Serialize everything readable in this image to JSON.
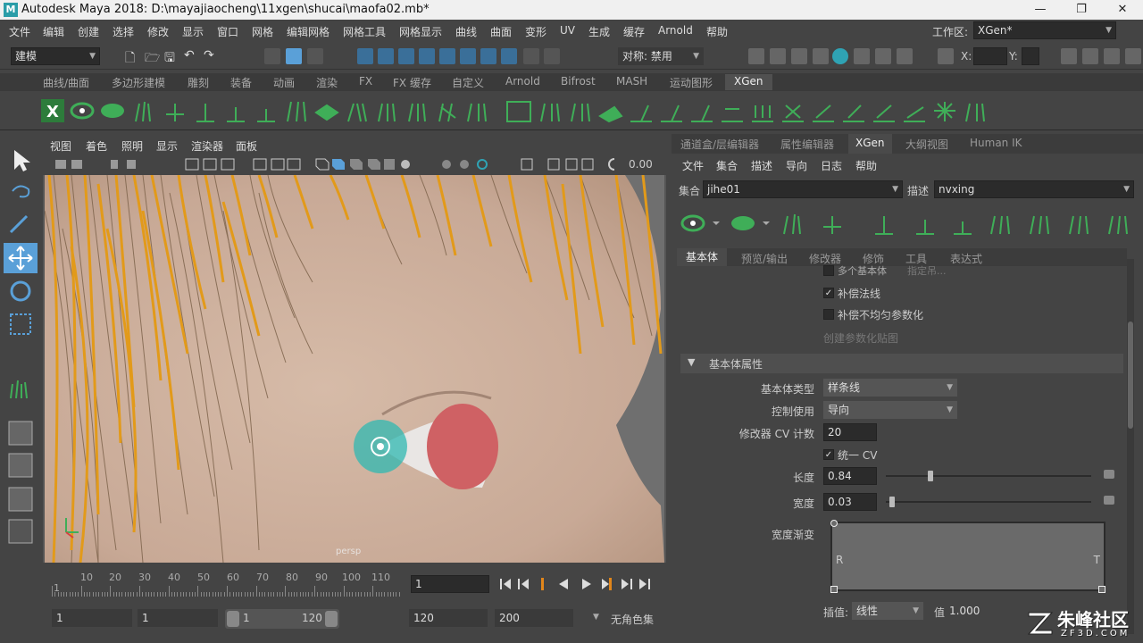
{
  "window": {
    "title": "Autodesk Maya 2018: D:\\mayajiaocheng\\11xgen\\shucai\\maofa02.mb*",
    "logo": "M",
    "controls": [
      "—",
      "❐",
      "✕"
    ]
  },
  "menubar": {
    "items": [
      "文件",
      "编辑",
      "创建",
      "选择",
      "修改",
      "显示",
      "窗口",
      "网格",
      "编辑网格",
      "网格工具",
      "网格显示",
      "曲线",
      "曲面",
      "变形",
      "UV",
      "生成",
      "缓存",
      "Arnold",
      "帮助"
    ],
    "workspace_label": "工作区:",
    "workspace_value": "XGen*"
  },
  "statusline": {
    "mode": "建模",
    "symmetry": "对称: 禁用",
    "x_label": "X:",
    "y_label": "Y:"
  },
  "shelf_tabs": {
    "items": [
      "曲线/曲面",
      "多边形建模",
      "雕刻",
      "装备",
      "动画",
      "渲染",
      "FX",
      "FX 缓存",
      "自定义",
      "Arnold",
      "Bifrost",
      "MASH",
      "运动图形",
      "XGen"
    ],
    "active": "XGen"
  },
  "viewport": {
    "menu": [
      "视图",
      "着色",
      "照明",
      "显示",
      "渲染器",
      "面板"
    ],
    "value": "0.00",
    "hud_label": "persp"
  },
  "right_panel": {
    "tabs": [
      "通道盒/层编辑器",
      "属性编辑器",
      "XGen",
      "大纲视图",
      "Human IK"
    ],
    "active_tab": "XGen",
    "menu": [
      "文件",
      "集合",
      "描述",
      "导向",
      "日志",
      "帮助"
    ],
    "collection_label": "集合",
    "collection_value": "jihe01",
    "description_label": "描述",
    "description_value": "nvxing",
    "sub_tabs": [
      "基本体",
      "预览/输出",
      "修改器",
      "修饰",
      "工具",
      "表达式"
    ],
    "active_sub_tab": "基本体",
    "options": {
      "multi_primitive": "多个基本体",
      "multi_primitive_hint": "指定吊...",
      "compensate_normals": "补偿法线",
      "compensate_uneven": "补偿不均匀参数化",
      "create_param_map": "创建参数化贴图"
    },
    "section_title": "基本体属性",
    "attrs": {
      "primitive_type_label": "基本体类型",
      "primitive_type_value": "样条线",
      "control_label": "控制使用",
      "control_value": "导向",
      "cv_count_label": "修改器 CV 计数",
      "cv_count_value": "20",
      "uniform_cv_label": "统一 CV",
      "length_label": "长度",
      "length_value": "0.84",
      "length_level": 0.21,
      "width_label": "宽度",
      "width_value": "0.03",
      "width_level": 0.02,
      "width_ramp_label": "宽度渐变",
      "ramp_left": "R",
      "ramp_right": "T",
      "interp_label": "插值:",
      "interp_value": "线性",
      "value_label": "值:",
      "value_value": "1.000"
    }
  },
  "timeline": {
    "ticks": [
      "1",
      "10",
      "20",
      "30",
      "40",
      "50",
      "60",
      "70",
      "80",
      "90",
      "100",
      "110"
    ],
    "current_frame": "1"
  },
  "range": {
    "start": "1",
    "anim_start": "1",
    "range_start": "1",
    "range_end": "120",
    "end": "120",
    "anim_end": "200",
    "char_set": "无角色集"
  },
  "watermark": {
    "text": "朱峰社区",
    "url": "ZF3D.COM"
  },
  "colors": {
    "accent": "#5aa0d8",
    "shelf_icon": "#3fae58",
    "hair_orange": "#e29a1a",
    "skin": "#c9ab97"
  }
}
